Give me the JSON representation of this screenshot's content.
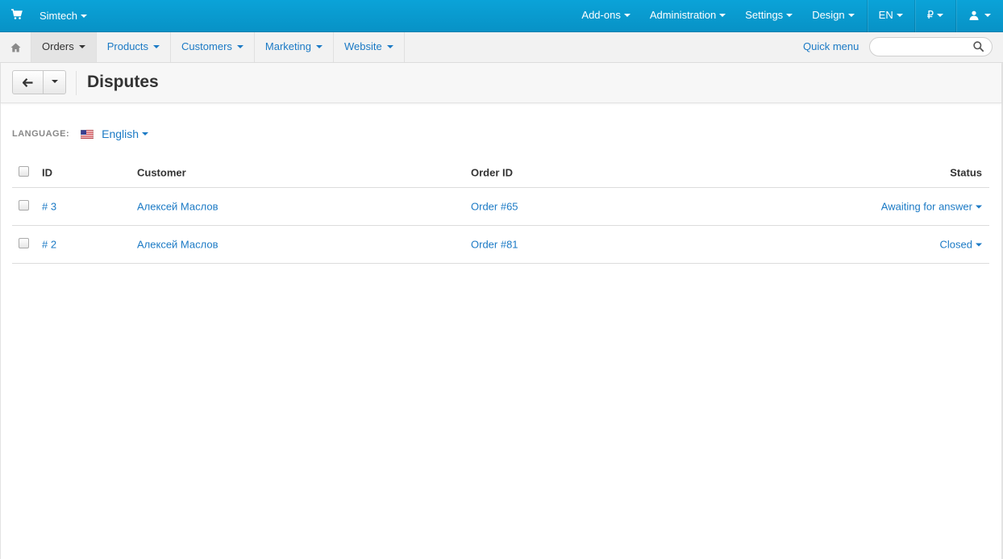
{
  "topbar": {
    "brand": "Simtech",
    "items": [
      {
        "label": "Add-ons"
      },
      {
        "label": "Administration"
      },
      {
        "label": "Settings"
      },
      {
        "label": "Design"
      },
      {
        "label": "EN"
      },
      {
        "label": "₽"
      }
    ]
  },
  "subnav": {
    "items": [
      {
        "label": "Orders"
      },
      {
        "label": "Products"
      },
      {
        "label": "Customers"
      },
      {
        "label": "Marketing"
      },
      {
        "label": "Website"
      }
    ],
    "quick_menu": "Quick menu",
    "search_placeholder": ""
  },
  "page": {
    "title": "Disputes"
  },
  "language": {
    "label": "LANGUAGE:",
    "value": "English"
  },
  "table": {
    "columns": {
      "id": "ID",
      "customer": "Customer",
      "order_id": "Order ID",
      "status": "Status"
    },
    "rows": [
      {
        "id": "# 3",
        "customer": "Алексей Маслов",
        "order_id": "Order #65",
        "status": "Awaiting for answer"
      },
      {
        "id": "# 2",
        "customer": "Алексей Маслов",
        "order_id": "Order #81",
        "status": "Closed"
      }
    ]
  },
  "colors": {
    "topbar": "#0aa3d8",
    "link": "#1b7ac5"
  }
}
